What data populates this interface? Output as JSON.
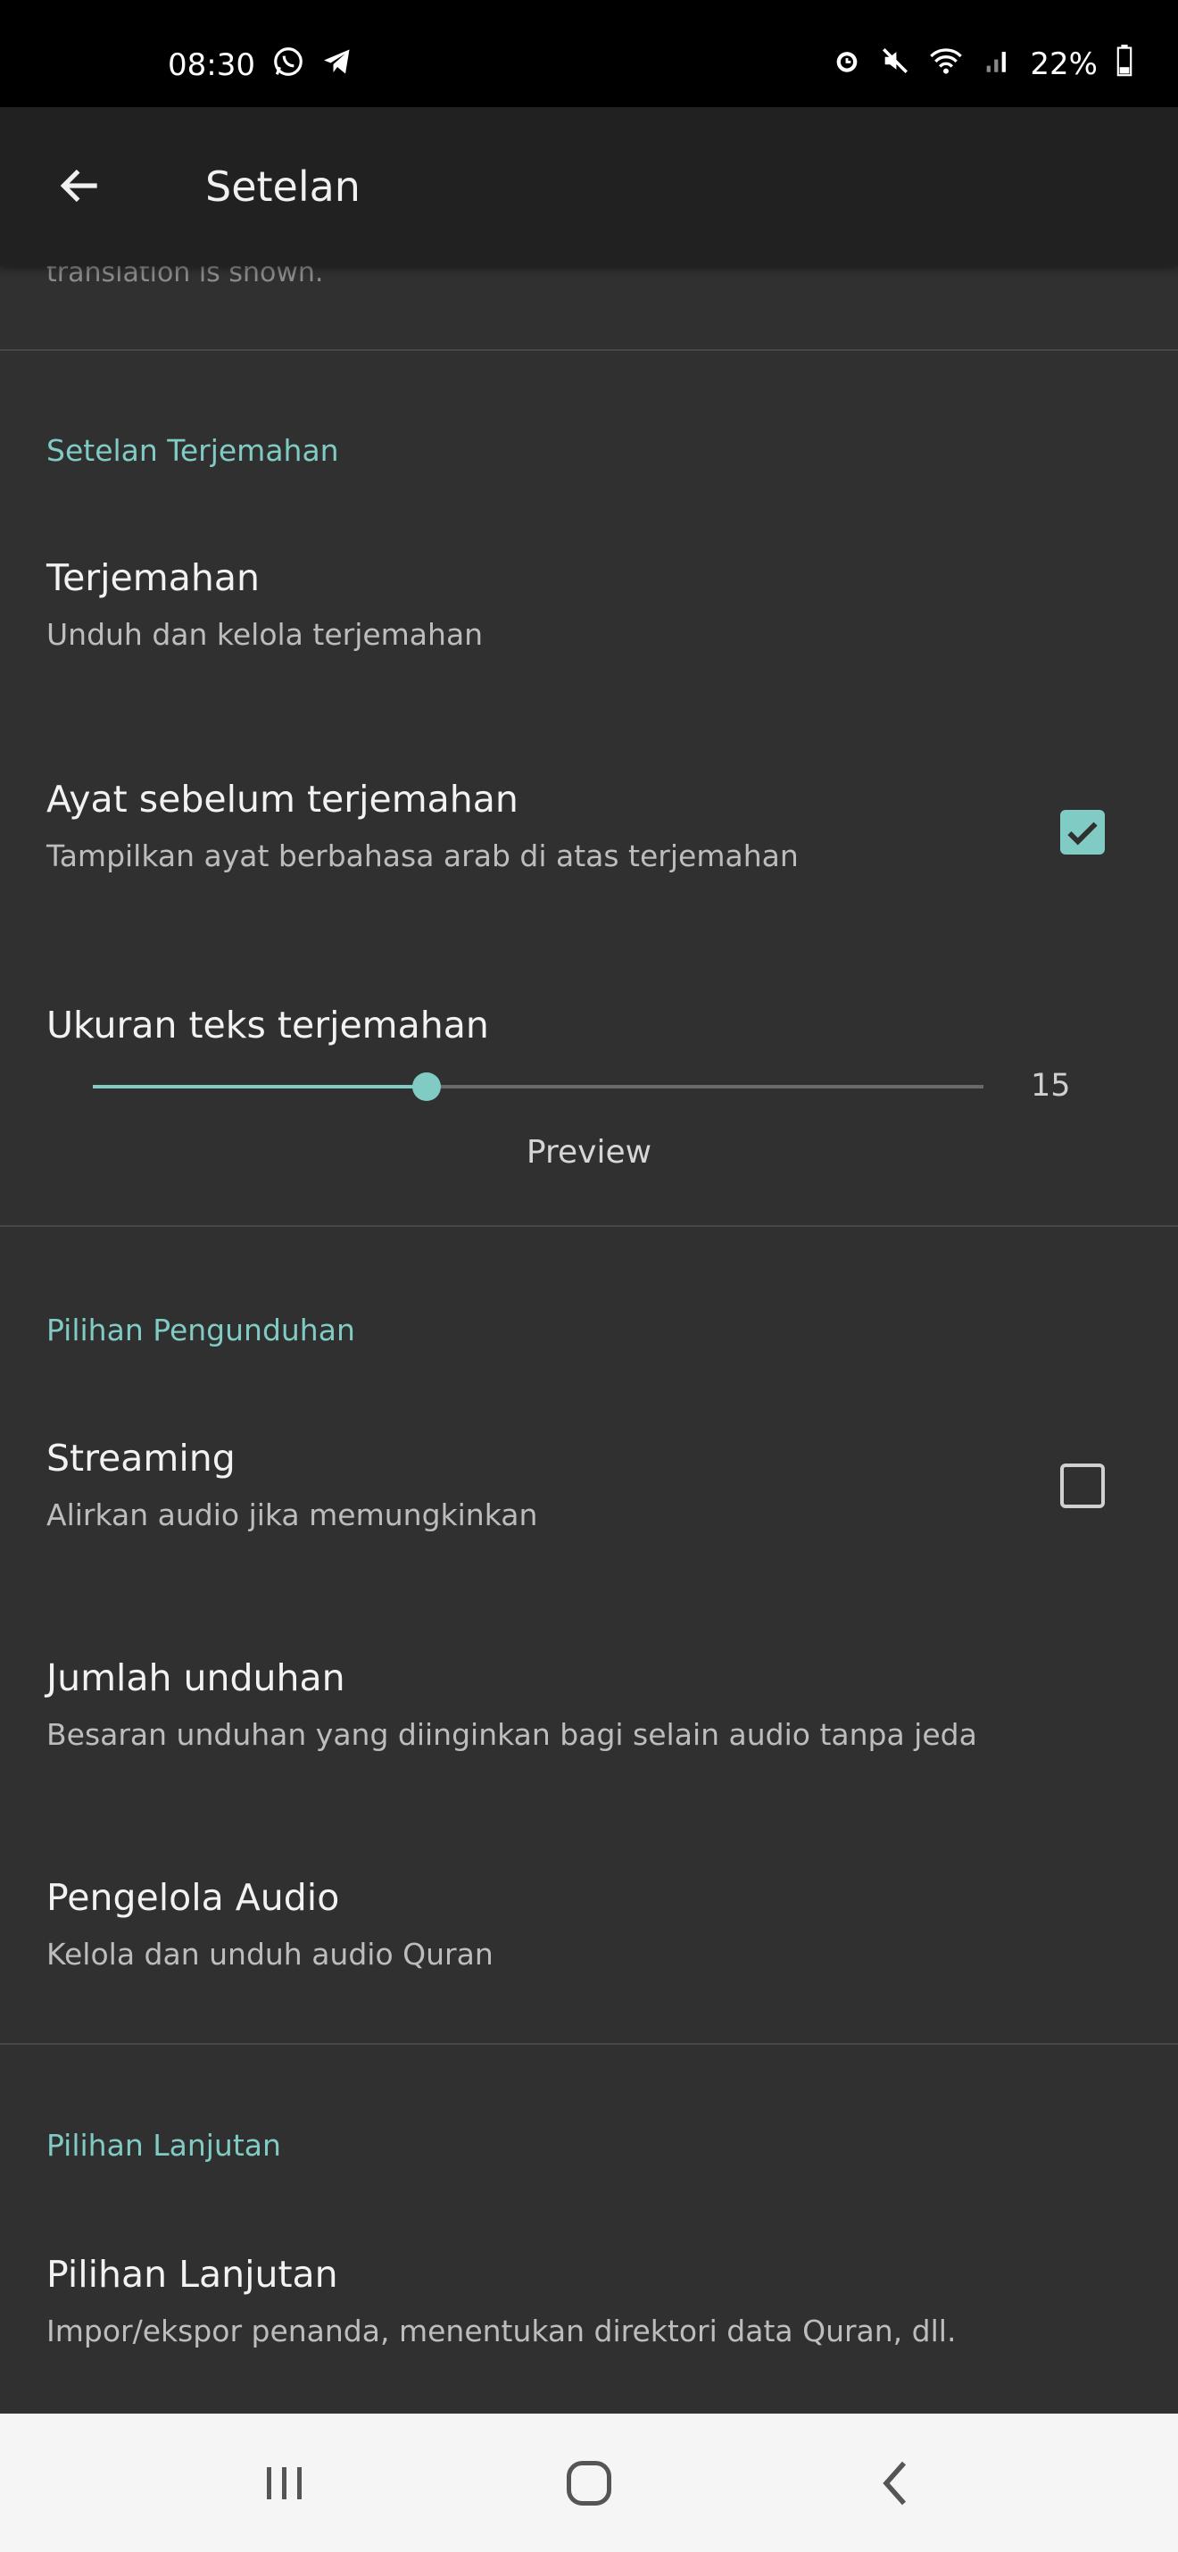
{
  "status_bar": {
    "time": "08:30",
    "left_icons": [
      "whatsapp-icon",
      "telegram-icon"
    ],
    "right_icons": [
      "alarm-icon",
      "mute-icon",
      "wifi-icon",
      "signal-icon"
    ],
    "battery": "22%"
  },
  "app_bar": {
    "title": "Setelan"
  },
  "cut_off_text": "translation is shown.",
  "sections": {
    "translation": {
      "title": "Setelan Terjemahan",
      "translations": {
        "title": "Terjemahan",
        "summary": "Unduh dan kelola terjemahan"
      },
      "ayah_before": {
        "title": "Ayat sebelum terjemahan",
        "summary": "Tampilkan ayat berbahasa arab di atas terjemahan",
        "checked": true
      },
      "text_size": {
        "title": "Ukuran teks terjemahan",
        "value": "15",
        "fraction": 0.375,
        "preview": "Preview"
      }
    },
    "download": {
      "title": "Pilihan Pengunduhan",
      "streaming": {
        "title": "Streaming",
        "summary": "Alirkan audio jika memungkinkan",
        "checked": false
      },
      "download_amount": {
        "title": "Jumlah unduhan",
        "summary": "Besaran unduhan yang diinginkan bagi selain audio tanpa jeda"
      },
      "audio_manager": {
        "title": "Pengelola Audio",
        "summary": "Kelola dan unduh audio Quran"
      }
    },
    "advanced": {
      "title": "Pilihan Lanjutan",
      "advanced_options": {
        "title": "Pilihan Lanjutan",
        "summary": "Impor/ekspor penanda, menentukan direktori data Quran, dll."
      }
    }
  },
  "colors": {
    "accent": "#80cbc4",
    "background": "#303030",
    "app_bar": "#212121"
  },
  "nav_bar": {
    "icons": [
      "recent-apps-icon",
      "home-icon",
      "back-icon"
    ]
  }
}
